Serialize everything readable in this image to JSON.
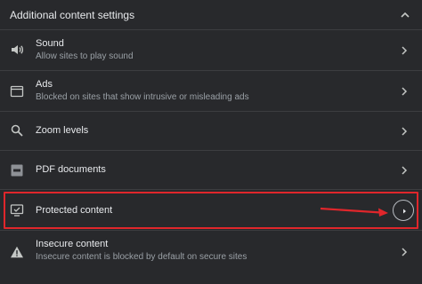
{
  "header": {
    "title": "Additional content settings"
  },
  "rows": [
    {
      "title": "Sound",
      "subtitle": "Allow sites to play sound",
      "icon": "speaker-icon"
    },
    {
      "title": "Ads",
      "subtitle": "Blocked on sites that show intrusive or misleading ads",
      "icon": "ads-window-icon"
    },
    {
      "title": "Zoom levels",
      "subtitle": "",
      "icon": "search-icon"
    },
    {
      "title": "PDF documents",
      "subtitle": "",
      "icon": "pdf-icon"
    },
    {
      "title": "Protected content",
      "subtitle": "",
      "icon": "protected-monitor-icon"
    },
    {
      "title": "Insecure content",
      "subtitle": "Insecure content is blocked by default on secure sites",
      "icon": "warning-icon"
    }
  ],
  "colors": {
    "background": "#28292c",
    "divider": "#3c3d40",
    "text_primary": "#e8eaed",
    "text_secondary": "#9aa0a6",
    "highlight_red": "#e0262b"
  }
}
